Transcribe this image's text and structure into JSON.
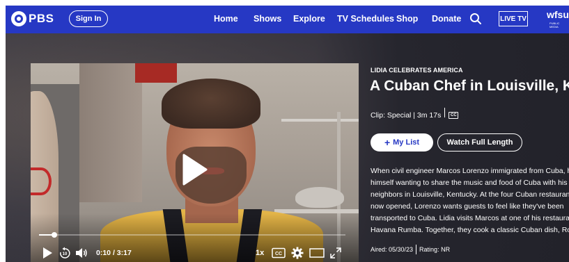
{
  "header": {
    "logo_text": "PBS",
    "sign_in_label": "Sign In",
    "nav": [
      "Home",
      "Shows",
      "Explore",
      "TV Schedules",
      "Shop",
      "Donate"
    ],
    "live_tv_label": "LIVE TV",
    "station_name": "wfsu",
    "station_subtitle": "PUBLIC MEDIA"
  },
  "player": {
    "current_time": "0:10",
    "separator": "/",
    "duration": "3:17",
    "progress_fraction": 0.051,
    "speed_label": "1x",
    "skip_back_label": "10",
    "cc_label": "CC"
  },
  "episode": {
    "show_name": "LIDIA CELEBRATES AMERICA",
    "title": "A Cuban Chef in Louisville, KY",
    "meta_text": "Clip: Special | 3m 17s",
    "cc_badge": "CC",
    "my_list_label": "My List",
    "my_list_icon": "+",
    "watch_full_label": "Watch Full Length",
    "description_lines": [
      "When civil engineer Marcos Lorenzo immigrated from Cuba, he fo",
      "himself wanting to share the music and food of Cuba with his",
      "neighbors in Louisville, Kentucky. At the four Cuban restaurants he",
      "now opened, Lorenzo wants guests to feel like they've been",
      "transported to Cuba. Lidia visits Marcos at one of his restaurants,",
      "Havana Rumba. Together, they cook a classic Cuban dish, Ropa Vie"
    ],
    "aired_text": "Aired: 05/30/23",
    "rating_text": "Rating: NR"
  },
  "colors": {
    "brand_blue": "#2638c4",
    "hero_bg": "#3c3c44",
    "text": "#ffffff"
  },
  "icons": [
    "pbs-logo-icon",
    "search-icon",
    "play-icon",
    "skip-back-10-icon",
    "volume-icon",
    "cc-icon",
    "settings-gear-icon",
    "theater-mode-icon",
    "fullscreen-icon"
  ]
}
